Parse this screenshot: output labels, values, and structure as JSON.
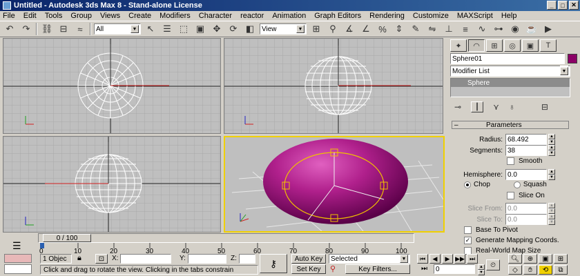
{
  "window": {
    "title": "Untitled - Autodesk 3ds Max 8 - Stand-alone License"
  },
  "menu": [
    "File",
    "Edit",
    "Tools",
    "Group",
    "Views",
    "Create",
    "Modifiers",
    "Character",
    "reactor",
    "Animation",
    "Graph Editors",
    "Rendering",
    "Customize",
    "MAXScript",
    "Help"
  ],
  "toolbar": {
    "selection_filter": "All",
    "reference_coord": "View"
  },
  "panel": {
    "object_name": "Sphere01",
    "object_color": "#8b0066",
    "modifier_list_label": "Modifier List",
    "stack_item": "Sphere",
    "rollout_title": "Parameters",
    "radius_label": "Radius:",
    "radius_value": "68.492",
    "segments_label": "Segments:",
    "segments_value": "38",
    "smooth_label": "Smooth",
    "smooth_checked": false,
    "hemisphere_label": "Hemisphere:",
    "hemisphere_value": "0.0",
    "chop_label": "Chop",
    "squash_label": "Squash",
    "slice_on_label": "Slice On",
    "slice_from_label": "Slice From:",
    "slice_from_value": "0.0",
    "slice_to_label": "Slice To:",
    "slice_to_value": "0.0",
    "base_to_pivot_label": "Base To Pivot",
    "base_to_pivot_checked": false,
    "gen_mapping_label": "Generate Mapping Coords.",
    "gen_mapping_checked": true,
    "real_world_label": "Real-World Map Size",
    "real_world_checked": false
  },
  "timeline": {
    "slider_label": "0 / 100",
    "ticks": [
      "0",
      "10",
      "20",
      "30",
      "40",
      "50",
      "60",
      "70",
      "80",
      "90",
      "100"
    ]
  },
  "status": {
    "selection_count": "1 Objec",
    "x_label": "X:",
    "y_label": "Y:",
    "z_label": "Z:",
    "prompt": "Click and drag to rotate the view.  Clicking in the tabs constrain",
    "auto_key": "Auto Key",
    "set_key": "Set Key",
    "key_mode": "Selected",
    "key_filters": "Key Filters...",
    "current_frame": "0"
  }
}
